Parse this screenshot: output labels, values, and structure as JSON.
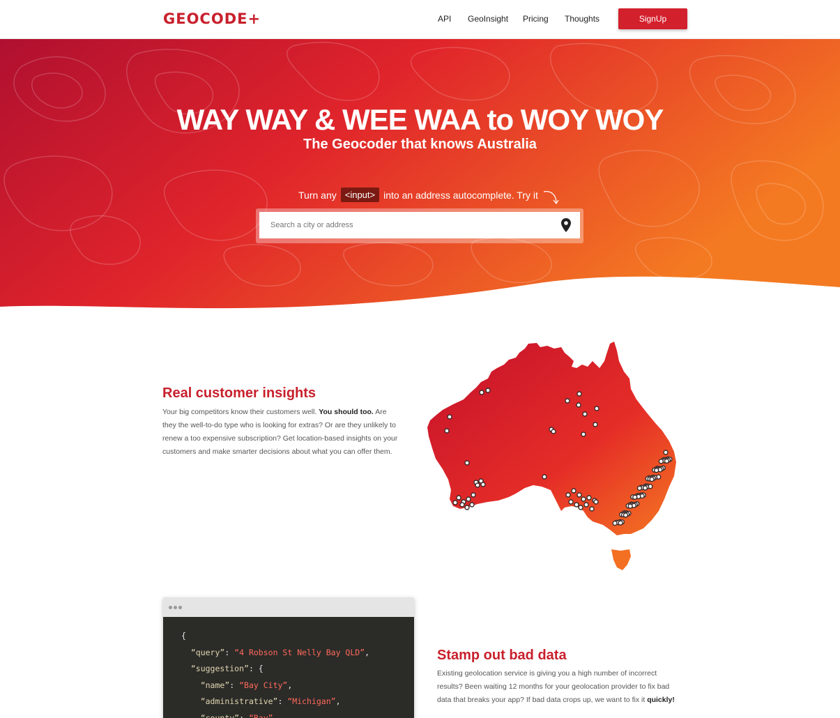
{
  "header": {
    "logo": "GEOCODE+",
    "nav": [
      "API",
      "GeoInsight",
      "Pricing",
      "Thoughts"
    ],
    "signup_label": "SignUp"
  },
  "hero": {
    "title": "WAY WAY & WEE WAA to WOY WOY",
    "subtitle": "The Geocoder that knows Australia",
    "try_prefix": "Turn any",
    "try_code": "<input>",
    "try_suffix": "into an address autocomplete. Try it",
    "search_placeholder": "Search a city or address",
    "search_icon": "map-pin-icon"
  },
  "insights": {
    "title": "Real customer insights",
    "body_start": "Your big competitors know their customers well.",
    "body_bold": "You should too.",
    "body_rest": "Are they the well-to-do type who is looking for extras? Or are they unlikely to renew a too expensive subscription? Get location-based insights on your customers and make smarter decisions about what you can offer them."
  },
  "bad_data": {
    "title": "Stamp out bad data",
    "body": "Existing geolocation service is giving you a high number of incorrect results? Been waiting 12 months for your geolocation provider to fix bad data that breaks your app? If bad data crops up, we want to fix it",
    "body_bold": "quickly!"
  },
  "code_sample": {
    "lines": [
      {
        "indent": 0,
        "text": "{"
      },
      {
        "indent": 1,
        "key": "“query”",
        "value": "“4 Robson St Nelly Bay QLD”",
        "end": ","
      },
      {
        "indent": 1,
        "key": "“suggestion”",
        "value": "",
        "end": ": {"
      },
      {
        "indent": 2,
        "key": "“name”",
        "value": "“Bay City”",
        "end": ","
      },
      {
        "indent": 2,
        "key": "“administrative”",
        "value": "“Michigan”",
        "end": ","
      },
      {
        "indent": 2,
        "key": "“county”",
        "value": "“Bay”",
        "end": ","
      }
    ]
  },
  "colors": {
    "brand": "#c8202c",
    "hero_left": "#b3112d",
    "hero_right": "#f37021"
  }
}
